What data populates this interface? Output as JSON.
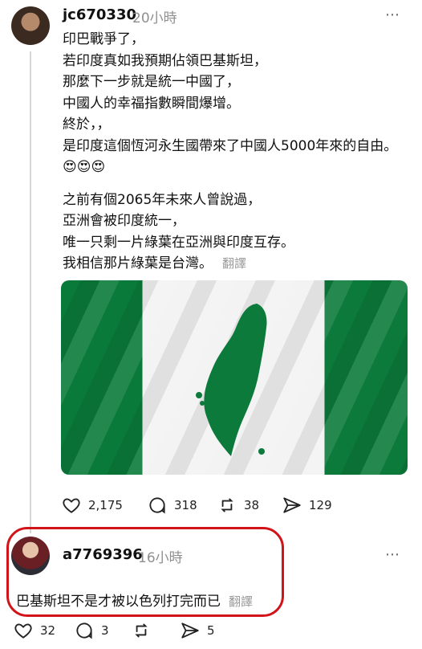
{
  "post": {
    "username": "jc670330",
    "time": "20小時",
    "paragraphs": [
      "印巴戰爭了，\n若印度真如我預期佔領巴基斯坦，\n那麼下一步就是統一中國了，\n中國人的幸福指數瞬間爆增。\n終於，，\n是印度這個恆河永生國帶來了中國人5000年來的自由。😍😍😍",
      "之前有個2065年未來人曾說過，\n亞洲會被印度統一，\n唯一只剩一片綠葉在亞洲與印度互存。\n我相信那片綠葉是台灣。"
    ],
    "translate_label": "翻譯",
    "stats": {
      "likes": "2,175",
      "comments": "318",
      "reposts": "38",
      "shares": "129"
    }
  },
  "reply": {
    "username": "a7769396",
    "time": "16小時",
    "text": "巴基斯坦不是才被以色列打完而已",
    "translate_label": "翻譯",
    "stats": {
      "likes": "32",
      "comments": "3",
      "reposts": "",
      "shares": "5"
    }
  },
  "icons": [
    "heart-icon",
    "comment-icon",
    "repost-icon",
    "share-icon",
    "more-icon"
  ],
  "colors": {
    "highlight": "#d1131a",
    "flag_green": "#0a7a3a"
  }
}
